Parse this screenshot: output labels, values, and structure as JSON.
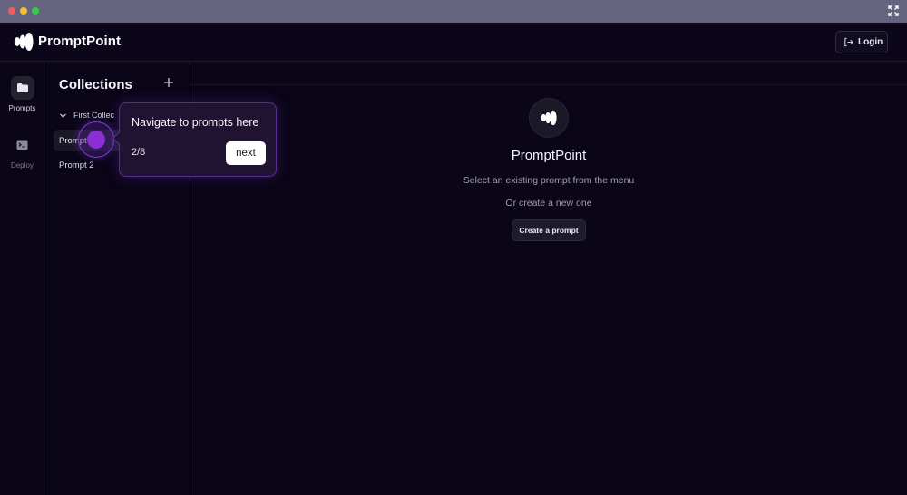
{
  "window": {
    "controls": [
      "close",
      "minimize",
      "zoom"
    ],
    "fullscreen_icon": "expand-icon"
  },
  "header": {
    "brand": "PromptPoint",
    "logo_icon": "promptpoint-logo-icon",
    "login_label": "Login",
    "login_icon": "login-icon"
  },
  "rail": {
    "items": [
      {
        "label": "Prompts",
        "icon": "folder-icon",
        "active": true
      },
      {
        "label": "Deploy",
        "icon": "terminal-icon",
        "active": false
      }
    ]
  },
  "collections": {
    "title": "Collections",
    "add_icon": "plus-icon",
    "folder": {
      "label": "First Collec",
      "icon": "chevron-down-icon"
    },
    "prompts": [
      {
        "label": "Prompt",
        "selected": true
      },
      {
        "label": "Prompt 2",
        "selected": false
      }
    ]
  },
  "main": {
    "title": "PromptPoint",
    "subtitle": "Select an existing prompt from the menu",
    "or_text": "Or create a new one",
    "create_button": "Create a prompt"
  },
  "tour": {
    "message": "Navigate to prompts here",
    "step": "2/8",
    "next_label": "next"
  },
  "colors": {
    "background": "#0a0517",
    "accent": "#8a2fd6",
    "tooltip_bg": "#1f1331"
  }
}
